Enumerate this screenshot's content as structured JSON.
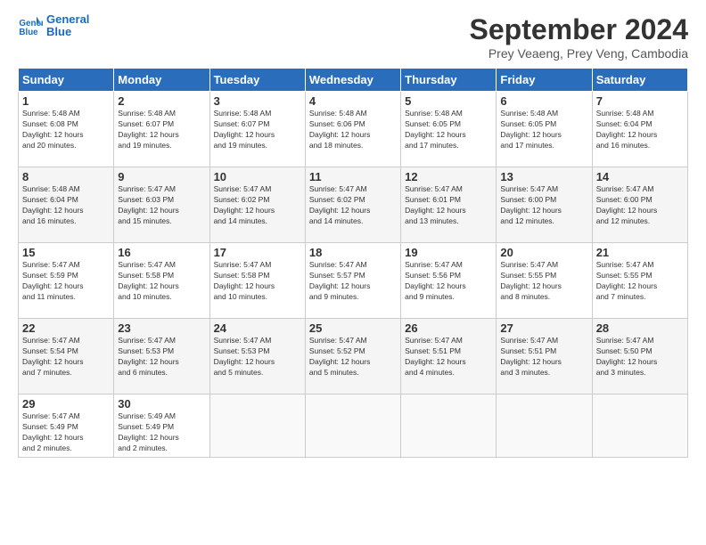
{
  "logo": {
    "line1": "General",
    "line2": "Blue"
  },
  "title": "September 2024",
  "subtitle": "Prey Veaeng, Prey Veng, Cambodia",
  "headers": [
    "Sunday",
    "Monday",
    "Tuesday",
    "Wednesday",
    "Thursday",
    "Friday",
    "Saturday"
  ],
  "weeks": [
    [
      {
        "day": "1",
        "info": "Sunrise: 5:48 AM\nSunset: 6:08 PM\nDaylight: 12 hours\nand 20 minutes."
      },
      {
        "day": "2",
        "info": "Sunrise: 5:48 AM\nSunset: 6:07 PM\nDaylight: 12 hours\nand 19 minutes."
      },
      {
        "day": "3",
        "info": "Sunrise: 5:48 AM\nSunset: 6:07 PM\nDaylight: 12 hours\nand 19 minutes."
      },
      {
        "day": "4",
        "info": "Sunrise: 5:48 AM\nSunset: 6:06 PM\nDaylight: 12 hours\nand 18 minutes."
      },
      {
        "day": "5",
        "info": "Sunrise: 5:48 AM\nSunset: 6:05 PM\nDaylight: 12 hours\nand 17 minutes."
      },
      {
        "day": "6",
        "info": "Sunrise: 5:48 AM\nSunset: 6:05 PM\nDaylight: 12 hours\nand 17 minutes."
      },
      {
        "day": "7",
        "info": "Sunrise: 5:48 AM\nSunset: 6:04 PM\nDaylight: 12 hours\nand 16 minutes."
      }
    ],
    [
      {
        "day": "8",
        "info": "Sunrise: 5:48 AM\nSunset: 6:04 PM\nDaylight: 12 hours\nand 16 minutes."
      },
      {
        "day": "9",
        "info": "Sunrise: 5:47 AM\nSunset: 6:03 PM\nDaylight: 12 hours\nand 15 minutes."
      },
      {
        "day": "10",
        "info": "Sunrise: 5:47 AM\nSunset: 6:02 PM\nDaylight: 12 hours\nand 14 minutes."
      },
      {
        "day": "11",
        "info": "Sunrise: 5:47 AM\nSunset: 6:02 PM\nDaylight: 12 hours\nand 14 minutes."
      },
      {
        "day": "12",
        "info": "Sunrise: 5:47 AM\nSunset: 6:01 PM\nDaylight: 12 hours\nand 13 minutes."
      },
      {
        "day": "13",
        "info": "Sunrise: 5:47 AM\nSunset: 6:00 PM\nDaylight: 12 hours\nand 12 minutes."
      },
      {
        "day": "14",
        "info": "Sunrise: 5:47 AM\nSunset: 6:00 PM\nDaylight: 12 hours\nand 12 minutes."
      }
    ],
    [
      {
        "day": "15",
        "info": "Sunrise: 5:47 AM\nSunset: 5:59 PM\nDaylight: 12 hours\nand 11 minutes."
      },
      {
        "day": "16",
        "info": "Sunrise: 5:47 AM\nSunset: 5:58 PM\nDaylight: 12 hours\nand 10 minutes."
      },
      {
        "day": "17",
        "info": "Sunrise: 5:47 AM\nSunset: 5:58 PM\nDaylight: 12 hours\nand 10 minutes."
      },
      {
        "day": "18",
        "info": "Sunrise: 5:47 AM\nSunset: 5:57 PM\nDaylight: 12 hours\nand 9 minutes."
      },
      {
        "day": "19",
        "info": "Sunrise: 5:47 AM\nSunset: 5:56 PM\nDaylight: 12 hours\nand 9 minutes."
      },
      {
        "day": "20",
        "info": "Sunrise: 5:47 AM\nSunset: 5:55 PM\nDaylight: 12 hours\nand 8 minutes."
      },
      {
        "day": "21",
        "info": "Sunrise: 5:47 AM\nSunset: 5:55 PM\nDaylight: 12 hours\nand 7 minutes."
      }
    ],
    [
      {
        "day": "22",
        "info": "Sunrise: 5:47 AM\nSunset: 5:54 PM\nDaylight: 12 hours\nand 7 minutes."
      },
      {
        "day": "23",
        "info": "Sunrise: 5:47 AM\nSunset: 5:53 PM\nDaylight: 12 hours\nand 6 minutes."
      },
      {
        "day": "24",
        "info": "Sunrise: 5:47 AM\nSunset: 5:53 PM\nDaylight: 12 hours\nand 5 minutes."
      },
      {
        "day": "25",
        "info": "Sunrise: 5:47 AM\nSunset: 5:52 PM\nDaylight: 12 hours\nand 5 minutes."
      },
      {
        "day": "26",
        "info": "Sunrise: 5:47 AM\nSunset: 5:51 PM\nDaylight: 12 hours\nand 4 minutes."
      },
      {
        "day": "27",
        "info": "Sunrise: 5:47 AM\nSunset: 5:51 PM\nDaylight: 12 hours\nand 3 minutes."
      },
      {
        "day": "28",
        "info": "Sunrise: 5:47 AM\nSunset: 5:50 PM\nDaylight: 12 hours\nand 3 minutes."
      }
    ],
    [
      {
        "day": "29",
        "info": "Sunrise: 5:47 AM\nSunset: 5:49 PM\nDaylight: 12 hours\nand 2 minutes."
      },
      {
        "day": "30",
        "info": "Sunrise: 5:49 AM\nSunset: 5:49 PM\nDaylight: 12 hours\nand 2 minutes."
      },
      {
        "day": "",
        "info": ""
      },
      {
        "day": "",
        "info": ""
      },
      {
        "day": "",
        "info": ""
      },
      {
        "day": "",
        "info": ""
      },
      {
        "day": "",
        "info": ""
      }
    ]
  ]
}
